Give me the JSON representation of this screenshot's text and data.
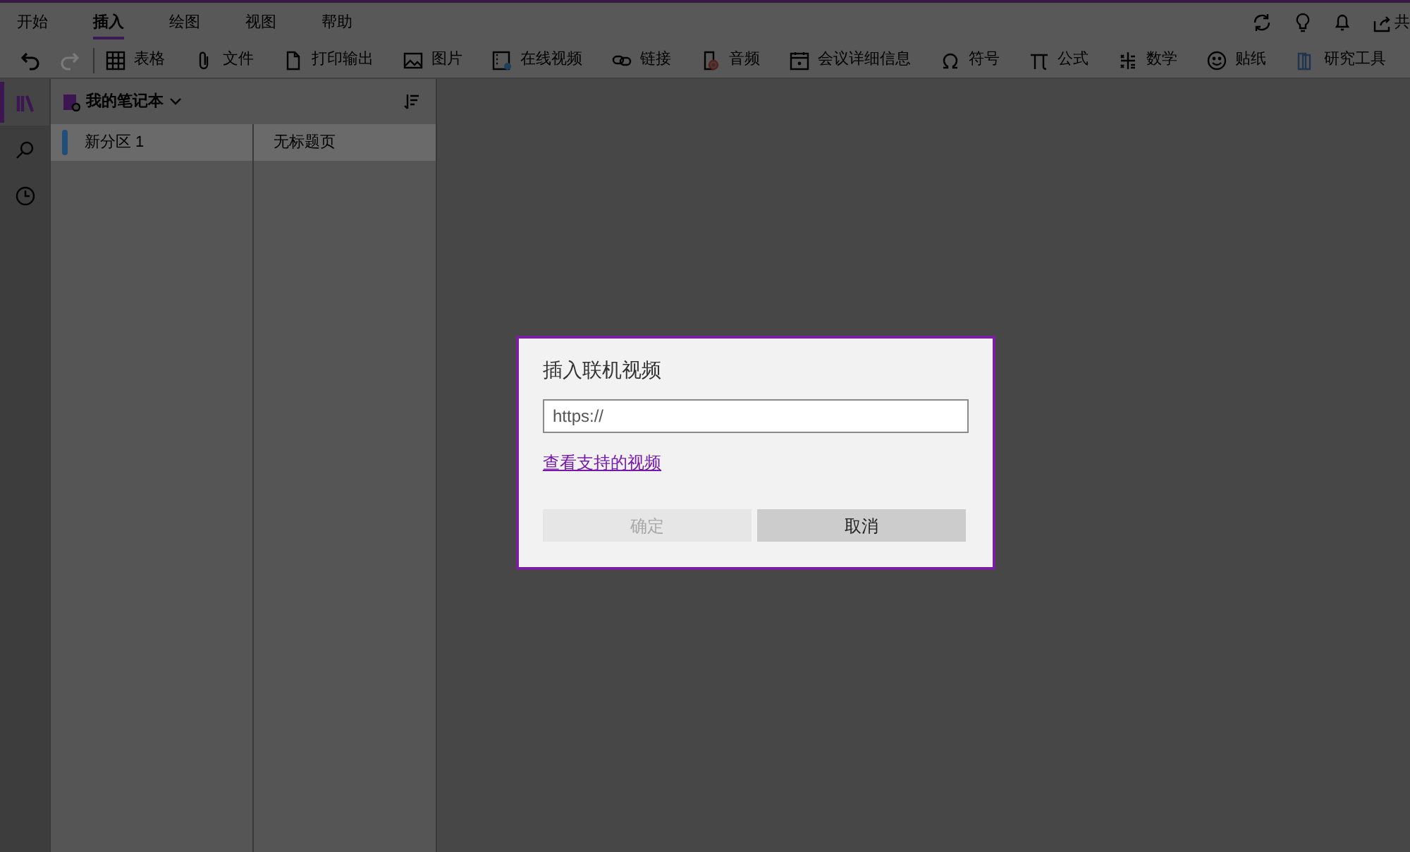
{
  "tabs": [
    {
      "label": "开始",
      "selected": false
    },
    {
      "label": "插入",
      "selected": true
    },
    {
      "label": "绘图",
      "selected": false
    },
    {
      "label": "视图",
      "selected": false
    },
    {
      "label": "帮助",
      "selected": false
    }
  ],
  "share": {
    "label": "共"
  },
  "history": [
    {
      "kind": "undo",
      "disabled": false
    },
    {
      "kind": "redo",
      "disabled": true
    }
  ],
  "toolbar": [
    {
      "kind": "table",
      "label": "表格"
    },
    {
      "kind": "file",
      "label": "文件"
    },
    {
      "kind": "printout",
      "label": "打印输出"
    },
    {
      "kind": "picture",
      "label": "图片"
    },
    {
      "kind": "video",
      "label": "在线视频"
    },
    {
      "kind": "link",
      "label": "链接"
    },
    {
      "kind": "audio",
      "label": "音频"
    },
    {
      "kind": "meeting",
      "label": "会议详细信息"
    },
    {
      "kind": "symbol",
      "label": "符号"
    },
    {
      "kind": "equation",
      "label": "公式"
    },
    {
      "kind": "math",
      "label": "数学"
    },
    {
      "kind": "sticker",
      "label": "贴纸"
    },
    {
      "kind": "research",
      "label": "研究工具"
    }
  ],
  "rail": [
    {
      "kind": "notebooks",
      "selected": true
    },
    {
      "kind": "search",
      "selected": false
    },
    {
      "kind": "recent",
      "selected": false
    }
  ],
  "notebook": {
    "title": "我的笔记本",
    "sections": [
      {
        "label": "新分区 1",
        "selected": true,
        "color": "#1e4e79"
      }
    ],
    "pages": [
      {
        "label": "无标题页",
        "selected": true
      }
    ]
  },
  "dialog": {
    "title": "插入联机视频",
    "url_field": {
      "placeholder": "https://"
    },
    "link": "查看支持的视频",
    "buttons": [
      {
        "label": "确定",
        "disabled": true
      },
      {
        "label": "取消",
        "disabled": false
      }
    ]
  }
}
